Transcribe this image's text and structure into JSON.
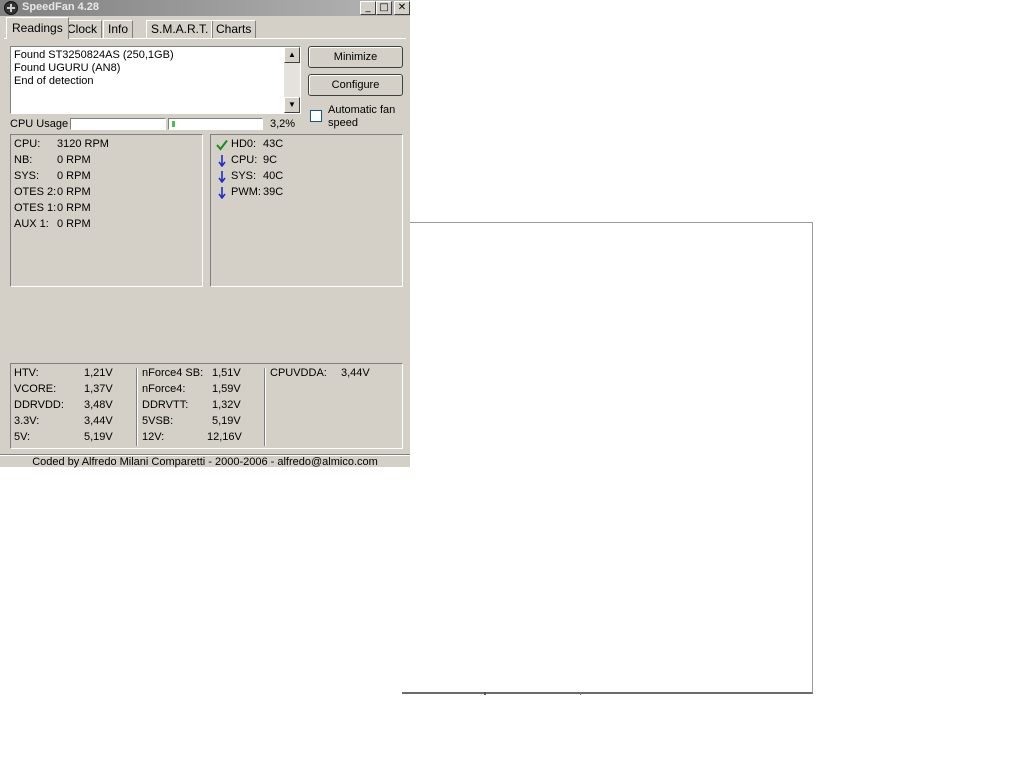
{
  "window": {
    "title": "SpeedFan 4.28"
  },
  "titlebar": {
    "minimize_glyph": "_",
    "maximize_glyph": "□",
    "close_glyph": "✕"
  },
  "tabs": [
    {
      "label": "Readings",
      "active": true
    },
    {
      "label": "Clock"
    },
    {
      "label": "Info"
    },
    {
      "label": "S.M.A.R.T."
    },
    {
      "label": "Charts"
    }
  ],
  "log": {
    "lines": [
      "Found ST3250824AS (250,1GB)",
      "Found UGURU (AN8)",
      "End of detection"
    ]
  },
  "buttons": {
    "minimize": "Minimize",
    "configure": "Configure"
  },
  "auto_fan": {
    "label": "Automatic fan speed",
    "checked": false
  },
  "cpu_usage": {
    "label": "CPU Usage",
    "value": "3,2%",
    "fill_percent": 3.2
  },
  "fans": [
    {
      "label": "CPU:",
      "value": "3120 RPM"
    },
    {
      "label": "NB:",
      "value": "0 RPM"
    },
    {
      "label": "SYS:",
      "value": "0 RPM"
    },
    {
      "label": "OTES 2:",
      "value": "0 RPM"
    },
    {
      "label": "OTES 1:",
      "value": "0 RPM"
    },
    {
      "label": "AUX 1:",
      "value": "0 RPM"
    }
  ],
  "temps": [
    {
      "icon": "check-icon",
      "label": "HD0:",
      "value": "43C"
    },
    {
      "icon": "arrow-down-icon",
      "label": "CPU:",
      "value": "9C"
    },
    {
      "icon": "arrow-down-icon",
      "label": "SYS:",
      "value": "40C"
    },
    {
      "icon": "arrow-down-icon",
      "label": "PWM:",
      "value": "39C"
    }
  ],
  "voltages": {
    "col1": [
      {
        "label": "HTV:",
        "value": "1,21V"
      },
      {
        "label": "VCORE:",
        "value": "1,37V"
      },
      {
        "label": "DDRVDD:",
        "value": "3,48V"
      },
      {
        "label": "3.3V:",
        "value": "3,44V"
      },
      {
        "label": "5V:",
        "value": "5,19V"
      }
    ],
    "col2": [
      {
        "label": "nForce4 SB:",
        "value": "1,51V"
      },
      {
        "label": "nForce4:",
        "value": "1,59V"
      },
      {
        "label": "DDRVTT:",
        "value": "1,32V"
      },
      {
        "label": "5VSB:",
        "value": "5,19V"
      },
      {
        "label": "12V:",
        "value": "12,16V"
      }
    ],
    "col3": [
      {
        "label": "CPUVDDA:",
        "value": "3,44V"
      }
    ]
  },
  "footer": "Coded by Alfredo Milani Comparetti - 2000-2006 - alfredo@almico.com",
  "colors": {
    "check": "#1a8a1a",
    "arrow": "#1e2fc8",
    "cpu_bar": "#46c24e"
  }
}
